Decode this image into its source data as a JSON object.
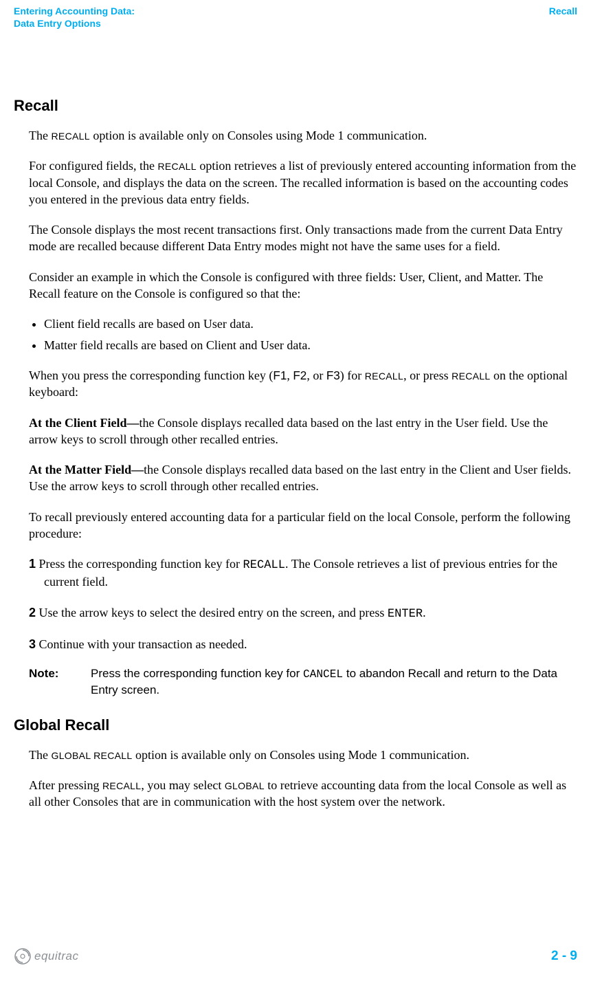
{
  "header": {
    "left_line1": "Entering Accounting Data:",
    "left_line2": "Data Entry Options",
    "right": "Recall"
  },
  "section1": {
    "heading": "Recall",
    "p1_a": "The ",
    "p1_sc1": "RECALL",
    "p1_b": " option is available only on Consoles using Mode 1 communication.",
    "p2_a": "For configured fields, the ",
    "p2_sc1": "RECALL",
    "p2_b": " option retrieves a list of previously entered accounting information from the local Console, and displays the data on the screen. The recalled information is based on the accounting codes you entered in the previous data entry fields.",
    "p3": "The Console displays the most recent transactions first. Only transactions made from the current Data Entry mode are recalled because different Data Entry modes might not have the same uses for a field.",
    "p4": "Consider an example in which the Console is configured with three fields: User, Client, and Matter. The Recall feature on the Console is configured so that the:",
    "bullets": [
      "Client field recalls are based on User data.",
      "Matter field recalls are based on Client and User data."
    ],
    "p5_a": "When you press the corresponding function key (",
    "p5_f1": "F1",
    "p5_b": ", ",
    "p5_f2": "F2",
    "p5_c": ", or ",
    "p5_f3": "F3",
    "p5_d": ") for ",
    "p5_sc1": "RECALL",
    "p5_e": ", or press ",
    "p5_sc2": "RECALL",
    "p5_f": " on the optional keyboard:",
    "p6_bold": "At the Client Field—",
    "p6_rest": "the Console displays recalled data based on the last entry in the User field. Use the arrow keys to scroll through other recalled entries.",
    "p7_bold": "At the Matter Field—",
    "p7_rest": "the Console displays recalled data based on the last entry in the Client and User fields. Use the arrow keys to scroll through other recalled entries.",
    "p8": "To recall previously entered accounting data for a particular field on the local Console, perform the following procedure:",
    "step1_num": "1",
    "step1_a": " Press the corresponding function key for ",
    "step1_mono": "RECALL",
    "step1_b": ". The Console retrieves a list of previous entries for the current field.",
    "step2_num": "2",
    "step2_a": " Use the arrow keys to select the desired entry on the screen, and press ",
    "step2_mono": "ENTER",
    "step2_b": ".",
    "step3_num": "3",
    "step3_a": " Continue with your transaction as needed.",
    "note_label": "Note:",
    "note_a": "Press the corresponding function key for ",
    "note_mono": "CANCEL",
    "note_b": "  to abandon Recall and return to the Data Entry screen."
  },
  "section2": {
    "heading": "Global Recall",
    "p1_a": "The ",
    "p1_sc1": "GLOBAL RECALL",
    "p1_b": " option is available only on Consoles using Mode 1 communication.",
    "p2_a": "After pressing ",
    "p2_sc1": "RECALL",
    "p2_b": ", you may select ",
    "p2_sc2": "GLOBAL",
    "p2_c": " to retrieve accounting data from the local Console as well as all other Consoles that are in communication with the host system over the network."
  },
  "footer": {
    "logo_text": "equitrac",
    "page_number": "2 - 9"
  }
}
